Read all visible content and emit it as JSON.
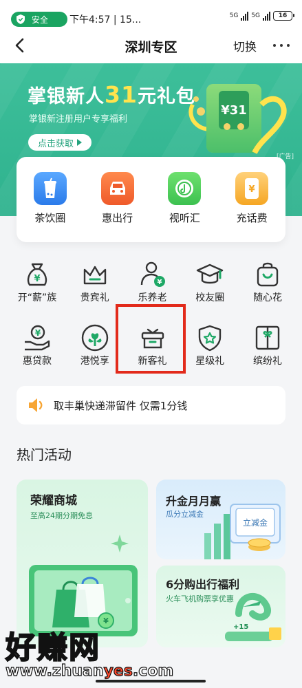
{
  "status_bar": {
    "safe_label": "安全",
    "time": "下午4:57 | 15...",
    "signal1": "5G",
    "signal2": "5G",
    "battery": "16"
  },
  "nav": {
    "title": "深圳专区",
    "switch_label": "切换"
  },
  "banner": {
    "title_prefix": "掌银新人",
    "title_num": "31",
    "title_suffix": "元礼包",
    "subtitle": "掌银新注册用户专享福利",
    "cta": "点击获取",
    "ad_tag": "[广告]",
    "coupon_text": "¥31"
  },
  "quick_items": [
    {
      "label": "茶饮圈",
      "icon": "tea-cup-icon",
      "color": "#3a8ef0"
    },
    {
      "label": "惠出行",
      "icon": "car-icon",
      "color": "#f2703a"
    },
    {
      "label": "视听汇",
      "icon": "music-disc-icon",
      "color": "#4ccf5c"
    },
    {
      "label": "充话费",
      "icon": "phone-bill-icon",
      "color": "#f5a623"
    }
  ],
  "grid_row1": [
    {
      "label": "开“薪”族",
      "icon": "money-bag-icon"
    },
    {
      "label": "贵宾礼",
      "icon": "crown-icon"
    },
    {
      "label": "乐养老",
      "icon": "elder-person-icon"
    },
    {
      "label": "校友圈",
      "icon": "graduation-cap-icon"
    },
    {
      "label": "随心花",
      "icon": "shopping-bag-icon"
    }
  ],
  "grid_row2": [
    {
      "label": "惠贷款",
      "icon": "loan-hand-icon"
    },
    {
      "label": "港悦享",
      "icon": "bauhinia-icon"
    },
    {
      "label": "新客礼",
      "icon": "gift-box-icon"
    },
    {
      "label": "星级礼",
      "icon": "star-shield-icon"
    },
    {
      "label": "缤纷礼",
      "icon": "gift-card-icon"
    }
  ],
  "notice": {
    "text": "取丰巢快递滞留件 仅需1分钱",
    "icon": "speaker-icon"
  },
  "hot": {
    "title": "热门活动",
    "card_a": {
      "title": "荣耀商城",
      "subtitle": "至高24期分期免息"
    },
    "card_b": {
      "title": "升金月月赢",
      "subtitle": "瓜分立减金",
      "badge": "立减金"
    },
    "card_c": {
      "title": "6分购出行福利",
      "subtitle": "火车飞机购票享优惠",
      "badge": "+15"
    }
  },
  "watermark": {
    "text": "好赚网",
    "url_a": "www.zhuan",
    "url_b": "yes",
    "url_c": ".com"
  },
  "colors": {
    "brand_green": "#2fb28e",
    "icon_green": "#1ea866",
    "highlight_red": "#e22a1b"
  }
}
